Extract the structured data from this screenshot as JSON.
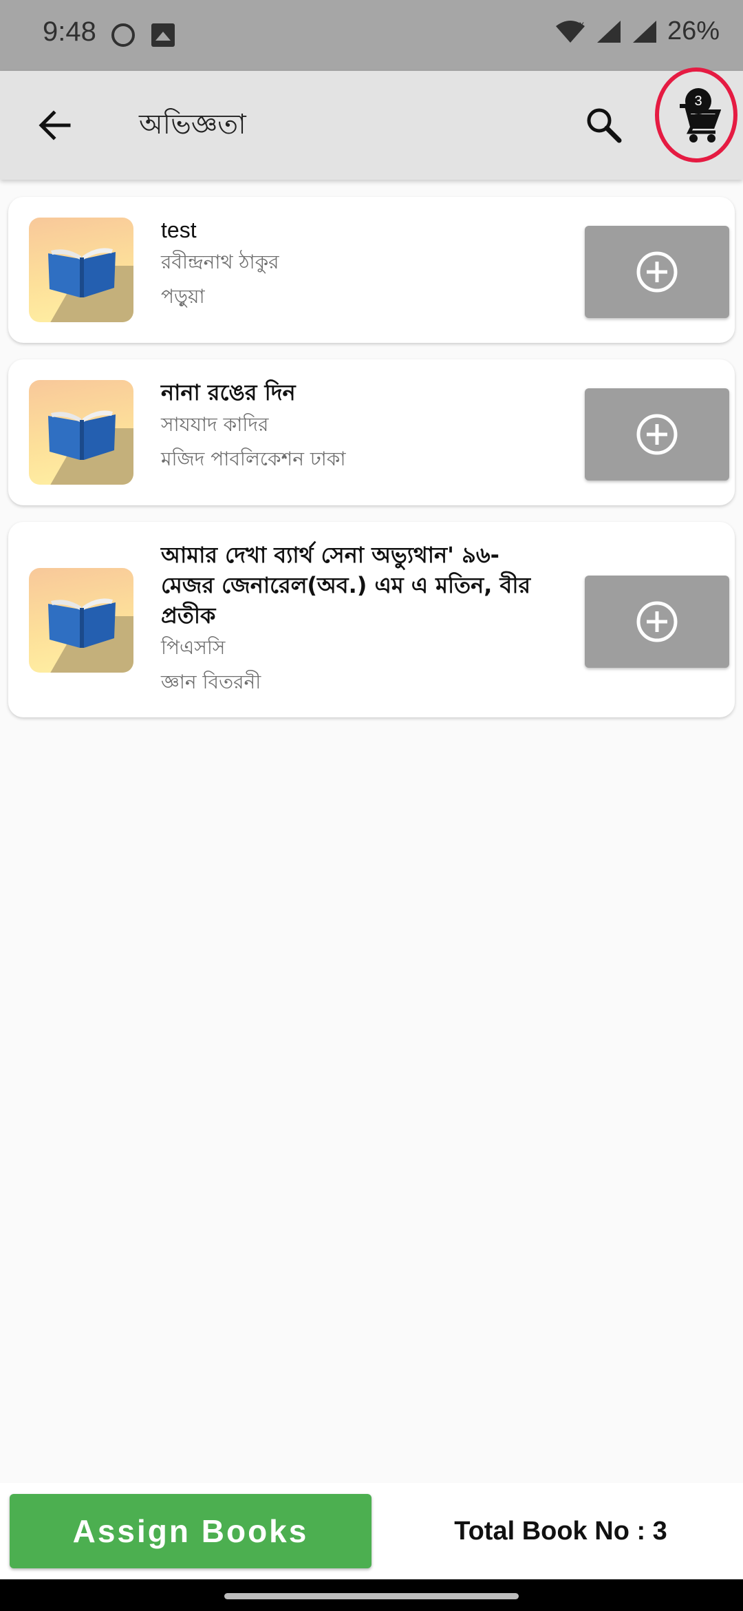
{
  "status_bar": {
    "time": "9:48",
    "battery": "26%"
  },
  "app_bar": {
    "title": "অভিজ্ঞতা",
    "cart_count": "3"
  },
  "books": [
    {
      "title": "test",
      "author": "রবীন্দ্রনাথ ঠাকুর",
      "publisher": "পড়ুয়া"
    },
    {
      "title": "নানা রঙের দিন",
      "author": "সাযযাদ কাদির",
      "publisher": "মজিদ পাবলিকেশন ঢাকা"
    },
    {
      "title": "আমার দেখা ব্যার্থ সেনা অভ্যুথান' ৯৬- মেজর জেনারেল(অব.) এম এ মতিন, বীর প্রতীক",
      "author": "পিএসসি",
      "publisher": "জ্ঞান বিতরনী"
    }
  ],
  "bottom": {
    "assign_label": "Assign Books",
    "total_label": "Total Book No : 3"
  },
  "icons": {
    "back": "arrow-left-icon",
    "search": "search-icon",
    "cart": "shopping-cart-icon",
    "add": "add-circle-icon",
    "book": "open-book-icon"
  },
  "colors": {
    "assign_button": "#4caf50",
    "cart_highlight": "#e51b42",
    "add_button": "#9e9e9e"
  }
}
